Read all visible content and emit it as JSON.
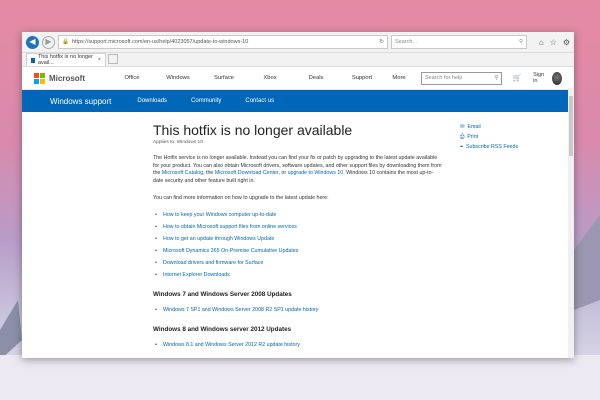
{
  "browser": {
    "url": "https://support.microsoft.com/en-us/help/4023057/update-to-windows-10",
    "search_placeholder": "Search...",
    "tab_title": "This hotfix is no longer avail..."
  },
  "ms_header": {
    "logo_text": "Microsoft",
    "nav": [
      "Office",
      "Windows",
      "Surface",
      "Xbox",
      "Deals",
      "Support",
      "More"
    ],
    "search_placeholder": "Search for help",
    "user": "Sign in"
  },
  "support_bar": {
    "brand": "Windows support",
    "links": [
      "Downloads",
      "Community",
      "Contact us"
    ]
  },
  "article": {
    "title": "This hotfix is no longer available",
    "applies": "Applies to: Windows 10",
    "para1_start": "The Hotfix service is no longer available. Instead you can find your fix or patch by upgrading to the latest update available for your product. You can also obtain Microsoft drivers, software updates, and other support files by downloading them from the ",
    "para1_link1": "Microsoft Catalog",
    "para1_mid1": ", the ",
    "para1_link2": "Microsoft Download Center",
    "para1_mid2": ", or ",
    "para1_link3": "upgrade to Windows 10",
    "para1_end": ". Windows 10 contains the most up-to-date security and other feature built right in.",
    "para2": "You can find more information on how to upgrade to the latest update here:",
    "links": [
      "How to keep your Windows computer up-to-date",
      "How to obtain Microsoft support files from online services",
      "How to get an update through Windows Update",
      "Microsoft Dynamics 365 On-Premise Cumulative Updates",
      "Download drivers and firmware for Surface",
      "Internet Explorer Downloads"
    ],
    "section1_title": "Windows 7 and Windows Server 2008 Updates",
    "section1_link": "Windows 7 SP1 and Windows Server 2008 R2 SP1 update history",
    "section2_title": "Windows 8 and Windows server 2012 Updates",
    "section2_link": "Windows 8.1 and Windows Server 2012 R2 update history"
  },
  "sidebar": {
    "email": "Email",
    "print": "Print",
    "rss": "Subscribe RSS Feeds"
  }
}
